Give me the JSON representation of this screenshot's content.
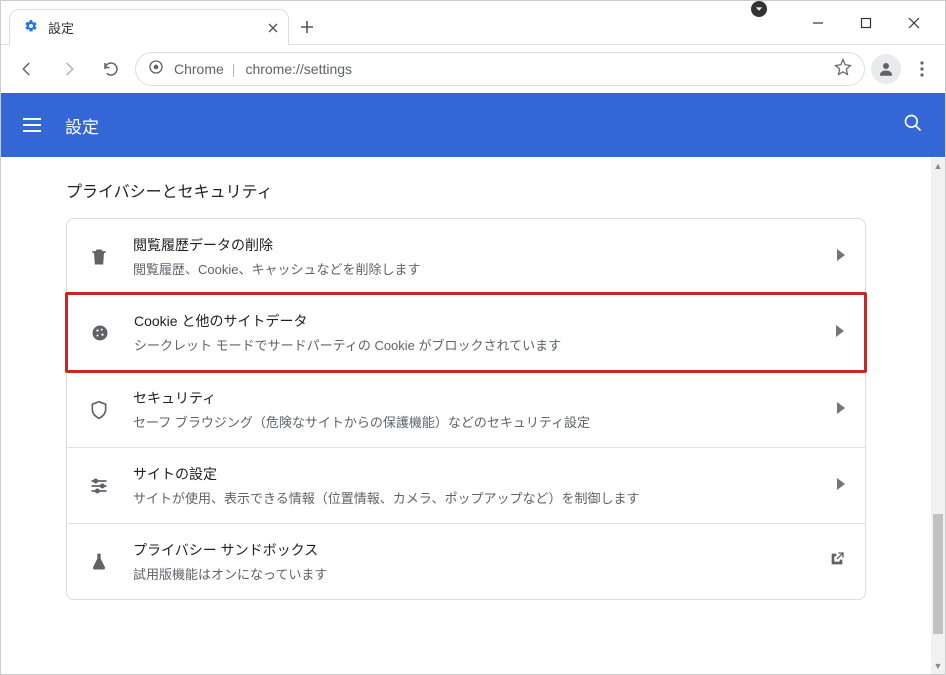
{
  "window": {
    "tab_title": "設定",
    "url_scheme_label": "Chrome",
    "url": "chrome://settings"
  },
  "header": {
    "title": "設定"
  },
  "section": {
    "title": "プライバシーとセキュリティ"
  },
  "rows": [
    {
      "title": "閲覧履歴データの削除",
      "desc": "閲覧履歴、Cookie、キャッシュなどを削除します"
    },
    {
      "title": "Cookie と他のサイトデータ",
      "desc": "シークレット モードでサードパーティの Cookie がブロックされています"
    },
    {
      "title": "セキュリティ",
      "desc": "セーフ ブラウジング（危険なサイトからの保護機能）などのセキュリティ設定"
    },
    {
      "title": "サイトの設定",
      "desc": "サイトが使用、表示できる情報（位置情報、カメラ、ポップアップなど）を制御します"
    },
    {
      "title": "プライバシー サンドボックス",
      "desc": "試用版機能はオンになっています"
    }
  ]
}
